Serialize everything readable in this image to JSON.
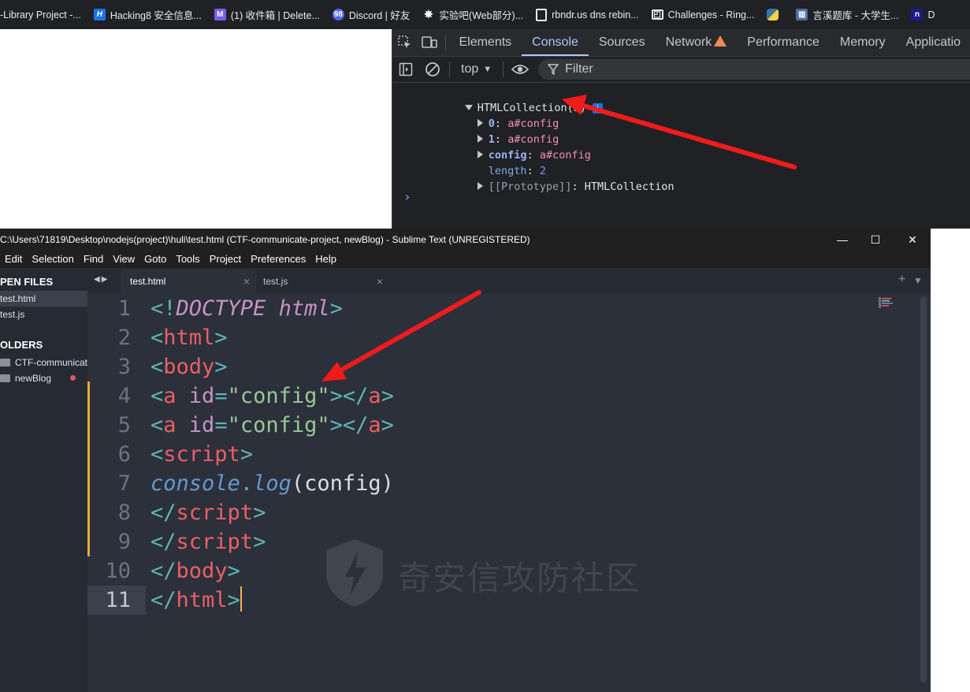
{
  "bookmarks": [
    {
      "label": "-Library Project -...",
      "icon": "bookmark-icon",
      "color": "#202124"
    },
    {
      "label": "Hacking8 安全信息...",
      "icon": "h-logo-icon",
      "color": "#1a73e8"
    },
    {
      "label": "(1) 收件箱 | Delete...",
      "icon": "mail-icon",
      "color": "#7b5cf0"
    },
    {
      "label": "Discord | 好友",
      "icon": "discord-icon",
      "color": "#5865f2"
    },
    {
      "label": "实验吧(Web部分)...",
      "icon": "gear-icon",
      "color": "#202124"
    },
    {
      "label": "rbndr.us dns rebin...",
      "icon": "page-icon",
      "color": "#202124"
    },
    {
      "label": "Challenges - Ring...",
      "icon": "ring-icon",
      "color": "#202124"
    },
    {
      "label": "",
      "icon": "python-icon",
      "color": "#3776ab"
    },
    {
      "label": "言溪题库 - 大学生...",
      "icon": "book-icon",
      "color": "#202124"
    },
    {
      "label": "D",
      "icon": "notion-icon",
      "color": "#1a1a8c"
    }
  ],
  "devtools": {
    "tabs": [
      "Elements",
      "Console",
      "Sources",
      "Network",
      "Performance",
      "Memory",
      "Applicatio"
    ],
    "active_tab": "Console",
    "context": "top",
    "filter_placeholder": "Filter",
    "console": {
      "collection_label": "HTMLCollection(2)",
      "info_badge": "i",
      "items": [
        {
          "key": "0",
          "sep": ": ",
          "value": "a#config"
        },
        {
          "key": "1",
          "sep": ": ",
          "value": "a#config"
        },
        {
          "key": "config",
          "sep": ": ",
          "value": "a#config"
        }
      ],
      "length_key": "length",
      "length_value": "2",
      "prototype_key": "[[Prototype]]",
      "prototype_value": "HTMLCollection",
      "prompt": "›"
    }
  },
  "sublime": {
    "title": "C:\\Users\\71819\\Desktop\\nodejs(project)\\huli\\test.html (CTF-communicate-project, newBlog) - Sublime Text (UNREGISTERED)",
    "menu": [
      "Edit",
      "Selection",
      "Find",
      "View",
      "Goto",
      "Tools",
      "Project",
      "Preferences",
      "Help"
    ],
    "sidebar": {
      "open_files_header": "PEN FILES",
      "open_files": [
        "test.html",
        "test.js"
      ],
      "folders_header": "OLDERS",
      "folders": [
        "CTF-communicate-project",
        "newBlog"
      ]
    },
    "tabs": [
      {
        "label": "test.html",
        "active": true
      },
      {
        "label": "test.js",
        "active": false
      }
    ],
    "line_numbers": [
      "1",
      "2",
      "3",
      "4",
      "5",
      "6",
      "7",
      "8",
      "9",
      "10",
      "11"
    ],
    "current_line": "11",
    "code": {
      "l1": {
        "a": "<!",
        "b": "DOCTYPE",
        "c": " ",
        "d": "html",
        "e": ">"
      },
      "l2": {
        "a": "<",
        "b": "html",
        "c": ">"
      },
      "l3": {
        "a": "<",
        "b": "body",
        "c": ">"
      },
      "l4": {
        "a": "<",
        "b": "a",
        "c": " ",
        "d": "id",
        "e": "=",
        "f": "\"config\"",
        "g": "></",
        "h": "a",
        "i": ">"
      },
      "l5": {
        "a": "<",
        "b": "a",
        "c": " ",
        "d": "id",
        "e": "=",
        "f": "\"config\"",
        "g": "></",
        "h": "a",
        "i": ">"
      },
      "l6": {
        "a": "<",
        "b": "script",
        "c": ">"
      },
      "l7": {
        "a": "console",
        "b": ".",
        "c": "log",
        "d": "(config)"
      },
      "l8": {
        "a": "</",
        "b": "script",
        "c": ">"
      },
      "l9": {
        "a": "</",
        "b": "script",
        "c": ">"
      },
      "l10": {
        "a": "</",
        "b": "body",
        "c": ">"
      },
      "l11": {
        "a": "</",
        "b": "html",
        "c": ">"
      }
    },
    "watermark": "奇安信攻防社区"
  },
  "colors": {
    "annotation_arrow": "#f01b1b",
    "accent": "#a8c7fa",
    "modified_marker": "#e5a83b"
  }
}
